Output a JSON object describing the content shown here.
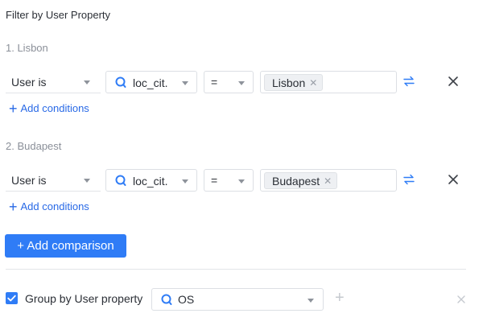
{
  "title": "Filter by User Property",
  "groups": [
    {
      "heading": "1. Lisbon",
      "subject": "User is",
      "property": "loc_cit.",
      "operator": "=",
      "value_tag": "Lisbon",
      "add_conditions": "Add conditions"
    },
    {
      "heading": "2. Budapest",
      "subject": "User is",
      "property": "loc_cit.",
      "operator": "=",
      "value_tag": "Budapest",
      "add_conditions": "Add conditions"
    }
  ],
  "add_comparison": "+ Add comparison",
  "group_by": {
    "checked": true,
    "label": "Group by User property",
    "property": "OS"
  },
  "icons": {
    "property": "search-property-icon",
    "swap": "swap-icon",
    "remove": "close-icon",
    "tag_remove": "tag-close-icon",
    "add": "plus-icon",
    "dropdown": "chevron-down-icon",
    "check": "checkmark-icon"
  },
  "colors": {
    "accent": "#2f7cf6",
    "link": "#2869e6",
    "muted_text": "#8b9099"
  }
}
